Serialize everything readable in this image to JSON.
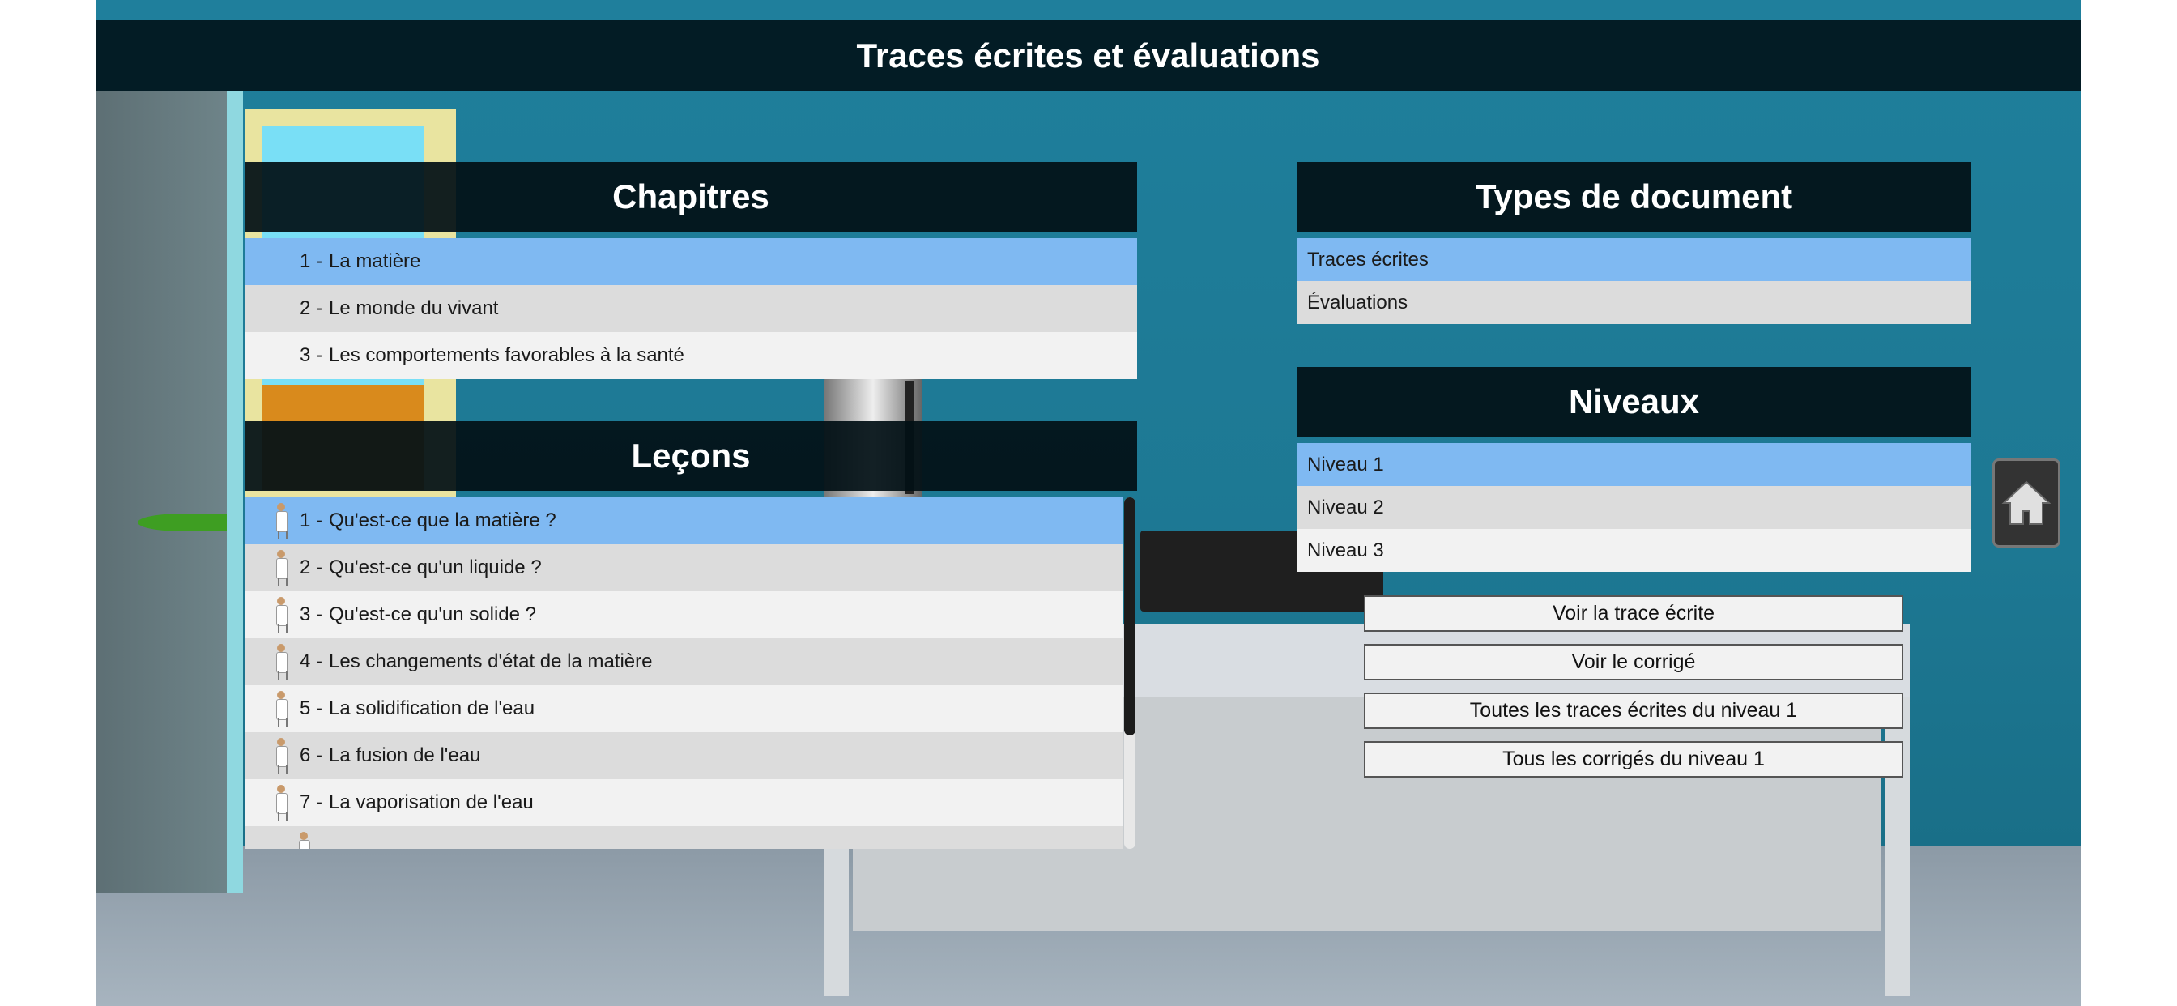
{
  "header": {
    "title": "Traces écrites et évaluations"
  },
  "chapitres": {
    "title": "Chapitres",
    "items": [
      {
        "num": "1 -",
        "label": "La matière",
        "selected": true
      },
      {
        "num": "2 -",
        "label": "Le monde du vivant",
        "selected": false
      },
      {
        "num": "3 -",
        "label": "Les comportements favorables à la santé",
        "selected": false
      }
    ]
  },
  "lecons": {
    "title": "Leçons",
    "items": [
      {
        "num": "1 -",
        "label": "Qu'est-ce que la matière ?",
        "selected": true
      },
      {
        "num": "2 -",
        "label": "Qu'est-ce qu'un liquide ?",
        "selected": false
      },
      {
        "num": "3 -",
        "label": "Qu'est-ce qu'un solide ?",
        "selected": false
      },
      {
        "num": "4 -",
        "label": "Les changements d'état de la matière",
        "selected": false
      },
      {
        "num": "5 -",
        "label": "La solidification de l'eau",
        "selected": false
      },
      {
        "num": "6 -",
        "label": "La fusion de l'eau",
        "selected": false
      },
      {
        "num": "7 -",
        "label": "La vaporisation de l'eau",
        "selected": false
      }
    ],
    "icon": "student-icon"
  },
  "types": {
    "title": "Types de document",
    "items": [
      {
        "label": "Traces écrites",
        "selected": true
      },
      {
        "label": "Évaluations",
        "selected": false
      }
    ]
  },
  "niveaux": {
    "title": "Niveaux",
    "items": [
      {
        "label": "Niveau 1",
        "selected": true
      },
      {
        "label": "Niveau 2",
        "selected": false
      },
      {
        "label": "Niveau 3",
        "selected": false
      }
    ]
  },
  "actions": {
    "voir_trace": "Voir la trace écrite",
    "voir_corrige": "Voir le corrigé",
    "toutes_traces": "Toutes les traces écrites du niveau 1",
    "tous_corriges": "Tous les corrigés du niveau 1"
  },
  "home_icon": "home-icon",
  "colors": {
    "selected": "#7fb9f2",
    "header_bg": "#02161c",
    "row_light": "#f2f2f2",
    "row_dark": "#dcdcdc"
  }
}
